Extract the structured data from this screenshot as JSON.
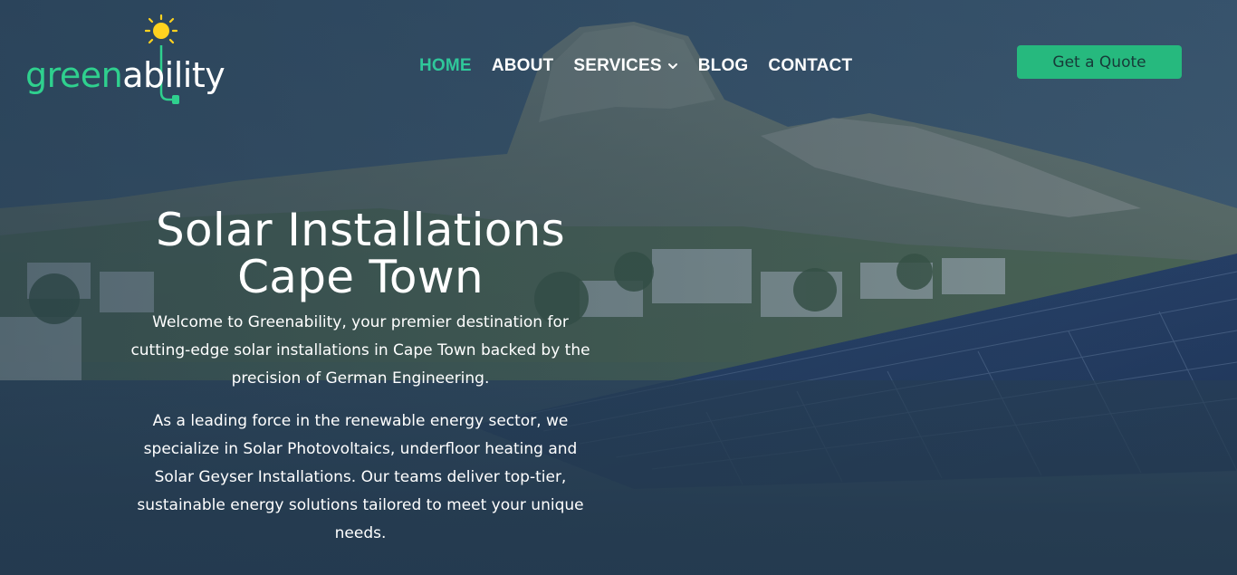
{
  "brand": {
    "logo_part1": "green",
    "logo_part2": "ability",
    "accent_color": "#2fd08e",
    "icons": [
      "sun-icon",
      "plug-icon"
    ]
  },
  "nav": {
    "items": [
      {
        "label": "HOME",
        "active": true
      },
      {
        "label": "ABOUT",
        "active": false
      },
      {
        "label": "SERVICES",
        "active": false,
        "dropdown": true
      },
      {
        "label": "BLOG",
        "active": false
      },
      {
        "label": "CONTACT",
        "active": false
      }
    ],
    "dropdown_icon": "chevron-down-icon"
  },
  "cta": {
    "label": "Get a Quote",
    "color": "#26b97e"
  },
  "hero": {
    "title_line1": "Solar Installations",
    "title_line2": "Cape Town",
    "paragraph1": "Welcome to Greenability, your premier destination for cutting-edge solar installations in Cape Town backed by the precision of German Engineering.",
    "paragraph2": "As a leading force in the renewable energy sector, we specialize in Solar Photovoltaics, underfloor heating and Solar Geyser Installations. Our teams deliver top-tier, sustainable energy solutions tailored to meet your unique needs."
  }
}
